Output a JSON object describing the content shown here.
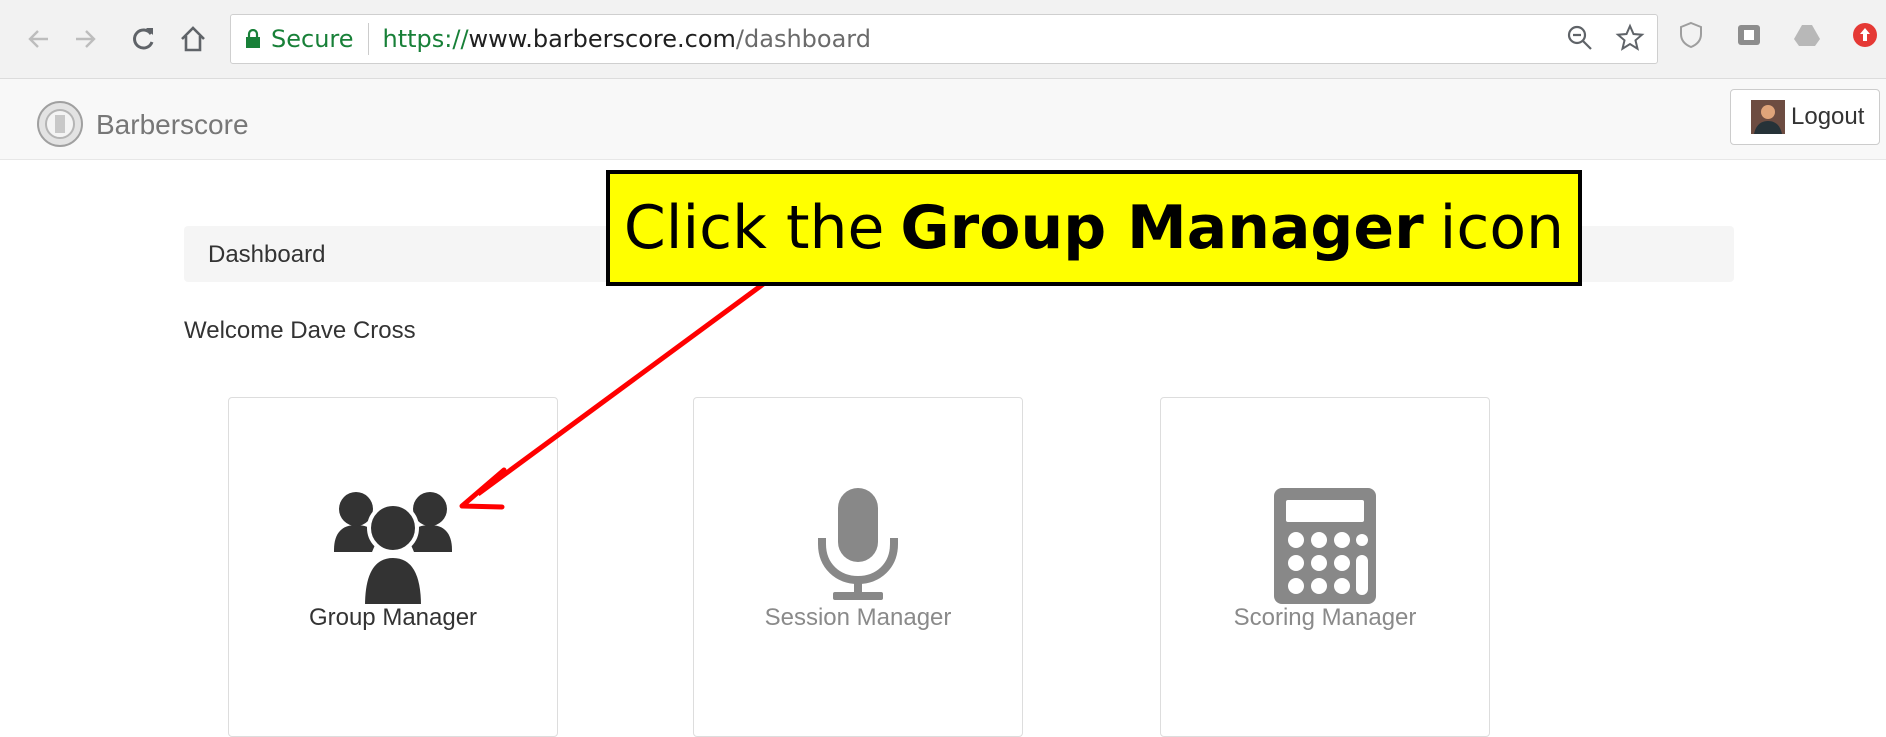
{
  "browser": {
    "secure_label": "Secure",
    "url_scheme": "https://",
    "url_host": "www.barberscore.com",
    "url_path": "/dashboard",
    "icons": [
      "back-icon",
      "forward-icon",
      "reload-icon",
      "home-icon",
      "lock-icon",
      "zoom-icon",
      "star-icon",
      "extension-icons"
    ]
  },
  "app": {
    "brand": "Barberscore",
    "logout_label": "Logout"
  },
  "breadcrumb": {
    "current": "Dashboard"
  },
  "welcome": "Welcome Dave Cross",
  "cards": [
    {
      "label": "Group Manager",
      "icon": "users-icon",
      "enabled": true
    },
    {
      "label": "Session Manager",
      "icon": "microphone-icon",
      "enabled": false
    },
    {
      "label": "Scoring Manager",
      "icon": "calculator-icon",
      "enabled": false
    }
  ],
  "annotation": {
    "prefix": "Click the",
    "bold": "Group Manager",
    "suffix": "icon",
    "colors": {
      "background": "#ffff00",
      "arrow": "#ff0000"
    }
  }
}
